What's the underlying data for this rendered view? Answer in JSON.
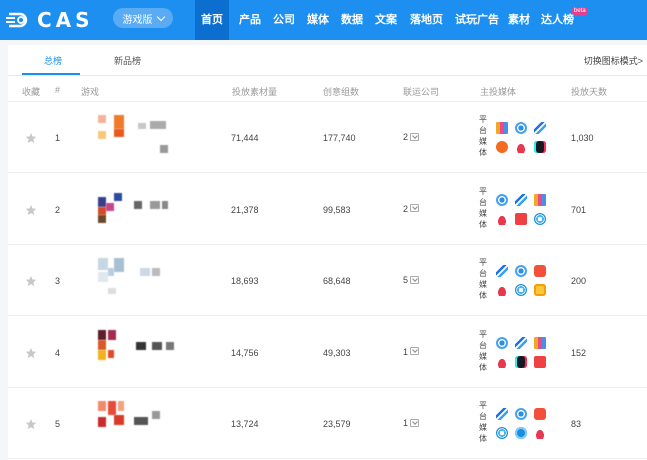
{
  "brand": {
    "name": "CAS"
  },
  "edition": {
    "label": "游戏版"
  },
  "nav": {
    "items": [
      "首页",
      "产品",
      "公司",
      "媒体",
      "数据",
      "文案",
      "落地页",
      "试玩广告",
      "素材",
      "达人榜"
    ],
    "active": "首页",
    "beta_badge": "beta"
  },
  "tabs": {
    "items": [
      "总榜",
      "新品榜"
    ],
    "active": "总榜"
  },
  "switch_mode_label": "切换图标模式>",
  "columns": [
    "收藏",
    "#",
    "游戏",
    "投放素材量",
    "创意组数",
    "联运公司",
    "主投媒体",
    "投放天数"
  ],
  "platform_label_chars": [
    "平",
    "台",
    "媒",
    "体"
  ],
  "colors": {
    "brand_blue": "#1c8ff0",
    "active_nav": "#0c6fd0",
    "star_gray": "#c8c8c8"
  },
  "rows": [
    {
      "rank": "1",
      "materials": "71,444",
      "creatives": "177,740",
      "companies": "2",
      "days": "1,030",
      "media_icons": [
        "bilibili-style-icon",
        "snowflake-icon",
        "wave-icon",
        "orange-play-icon",
        "red-cloud-icon",
        "douyin-icon"
      ]
    },
    {
      "rank": "2",
      "materials": "21,378",
      "creatives": "99,583",
      "companies": "2",
      "days": "701",
      "media_icons": [
        "snowflake-icon",
        "wave-icon",
        "bilibili-style-icon",
        "red-cloud-icon",
        "toutiao-icon",
        "swirl-icon"
      ]
    },
    {
      "rank": "3",
      "materials": "18,693",
      "creatives": "68,648",
      "companies": "5",
      "days": "200",
      "media_icons": [
        "wave-icon",
        "snowflake-icon",
        "red-badge-icon",
        "red-cloud-icon",
        "swirl-icon",
        "yellow-app-icon"
      ]
    },
    {
      "rank": "4",
      "materials": "14,756",
      "creatives": "49,303",
      "companies": "1",
      "days": "152",
      "media_icons": [
        "snowflake-icon",
        "wave-icon",
        "bilibili-style-icon",
        "red-cloud-icon",
        "douyin-icon",
        "toutiao-icon"
      ]
    },
    {
      "rank": "5",
      "materials": "13,724",
      "creatives": "23,579",
      "companies": "1",
      "days": "83",
      "media_icons": [
        "wave-icon",
        "snowflake-icon",
        "red-badge-icon",
        "swirl-icon",
        "kuaishou-icon",
        "red-cloud-icon"
      ]
    }
  ]
}
